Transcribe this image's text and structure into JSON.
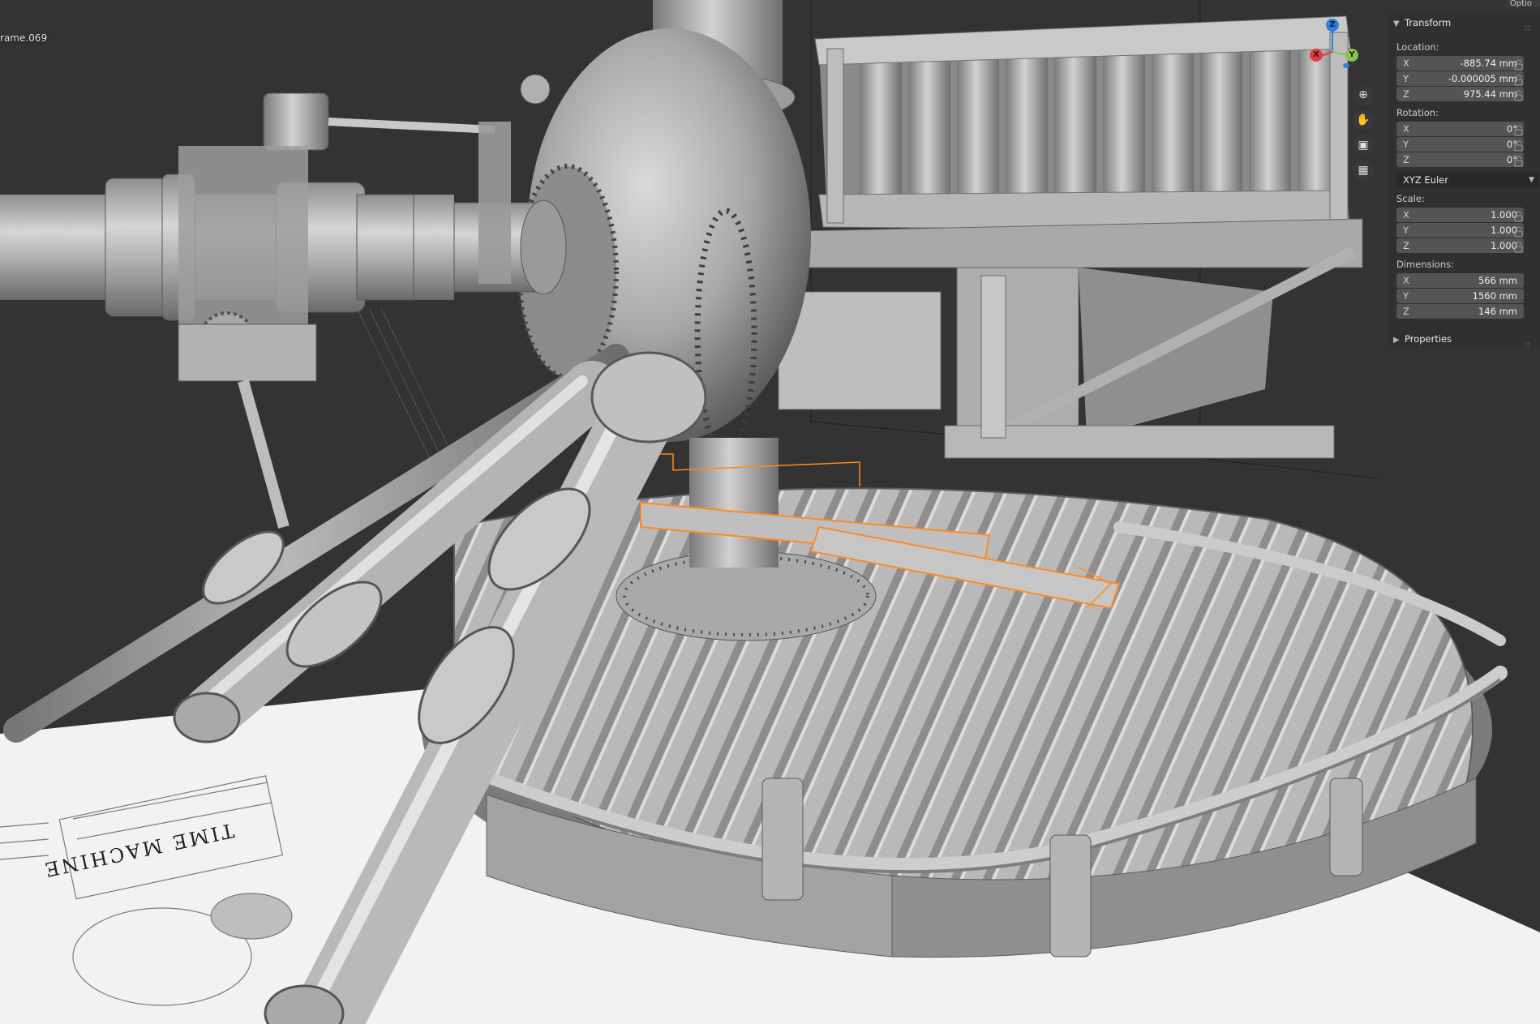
{
  "viewport": {
    "object_name": "rame.069",
    "options_tab": "Optio",
    "blueprint_text": "TIME MACHINE",
    "gizmo": {
      "axes": [
        {
          "label": "Z",
          "color": "#2f7fe0"
        },
        {
          "label": "Y",
          "color": "#8bc34a"
        },
        {
          "label": "X",
          "color": "#e53946"
        }
      ]
    },
    "nav_icons": [
      "zoom-icon",
      "pan-hand-icon",
      "camera-icon",
      "grid-view-icon"
    ],
    "selection_outline_color": "#ff8a1f"
  },
  "transform_panel": {
    "title": "Transform",
    "location_label": "Location:",
    "location": [
      {
        "axis": "X",
        "value": "-885.74 mm"
      },
      {
        "axis": "Y",
        "value": "-0.000005 mm"
      },
      {
        "axis": "Z",
        "value": "975.44 mm"
      }
    ],
    "rotation_label": "Rotation:",
    "rotation": [
      {
        "axis": "X",
        "value": "0°"
      },
      {
        "axis": "Y",
        "value": "0°"
      },
      {
        "axis": "Z",
        "value": "0°"
      }
    ],
    "rotation_mode": "XYZ Euler",
    "scale_label": "Scale:",
    "scale": [
      {
        "axis": "X",
        "value": "1.000"
      },
      {
        "axis": "Y",
        "value": "1.000"
      },
      {
        "axis": "Z",
        "value": "1.000"
      }
    ],
    "dimensions_label": "Dimensions:",
    "dimensions": [
      {
        "axis": "X",
        "value": "566 mm"
      },
      {
        "axis": "Y",
        "value": "1560 mm"
      },
      {
        "axis": "Z",
        "value": "146 mm"
      }
    ]
  },
  "properties_panel": {
    "title": "Properties"
  }
}
